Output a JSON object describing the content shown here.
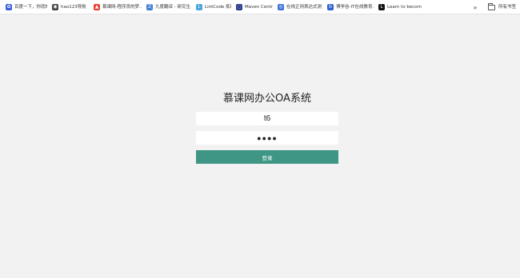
{
  "bookmarks": [
    {
      "label": "百度一下，你就知道",
      "icon": "baidu-paw-icon",
      "color": "#3c5fd8",
      "glyph": "✿"
    },
    {
      "label": "hao123导航",
      "icon": "globe-icon",
      "color": "#444444",
      "glyph": "◉"
    },
    {
      "label": "慕课网-程序员的梦...",
      "icon": "imooc-flame-icon",
      "color": "#e8402e",
      "glyph": "▲"
    },
    {
      "label": "九度翻译 - 研究生...",
      "icon": "translate-icon",
      "color": "#3a7bd5",
      "glyph": "文"
    },
    {
      "label": "LintCode 炼码",
      "icon": "lintcode-icon",
      "color": "#4aa3df",
      "glyph": "L"
    },
    {
      "label": "Maven Central",
      "icon": "maven-icon",
      "color": "#2b3a8c",
      "glyph": "◌"
    },
    {
      "label": "在线正则表达式测试",
      "icon": "regex-icon",
      "color": "#3b6fd6",
      "glyph": "◎"
    },
    {
      "label": "博学谷-IT在线教育...",
      "icon": "boxuegu-icon",
      "color": "#2f5fd0",
      "glyph": "b"
    },
    {
      "label": "Learn to become...",
      "icon": "learn-icon",
      "color": "#111111",
      "glyph": "L"
    }
  ],
  "bookmarks_overflow": "»",
  "all_bookmarks_label": "所有书签",
  "login": {
    "title": "慕课网办公OA系统",
    "username_value": "t6",
    "password_value": "●●●●",
    "submit_label": "登录",
    "accent_color": "#3f9685"
  }
}
